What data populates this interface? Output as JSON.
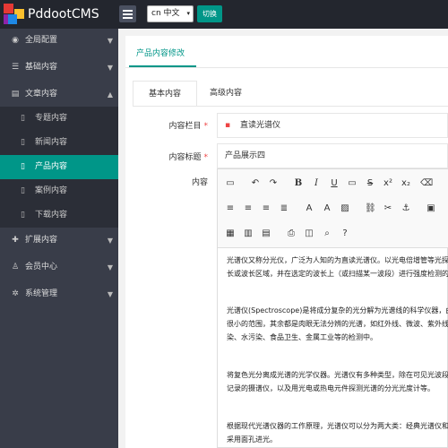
{
  "header": {
    "brand": "PddootCMS",
    "lang_value": "cn 中文",
    "switch_label": "切换"
  },
  "sidebar": {
    "items": [
      {
        "label": "全局配置",
        "icon": "globe-icon"
      },
      {
        "label": "基础内容",
        "icon": "sliders-icon"
      },
      {
        "label": "文章内容",
        "icon": "file-icon"
      },
      {
        "label": "扩展内容",
        "icon": "puzzle-icon"
      },
      {
        "label": "会员中心",
        "icon": "user-icon"
      },
      {
        "label": "系统管理",
        "icon": "gear-icon"
      }
    ],
    "subitems": [
      {
        "label": "专题内容"
      },
      {
        "label": "新闻内容"
      },
      {
        "label": "产品内容"
      },
      {
        "label": "案例内容"
      },
      {
        "label": "下载内容"
      }
    ]
  },
  "page": {
    "main_tab": "产品内容修改",
    "subtabs": [
      "基本内容",
      "高级内容"
    ],
    "fields": {
      "column_label": "内容栏目",
      "column_value": "直读光谱仪",
      "title_label": "内容标题",
      "title_value": "产品展示四",
      "content_label": "内容"
    },
    "body_paragraphs": [
      "光谱仪又称分光仪，广泛为人知的为直读光谱仪。以光电倍增管等光探测器测量谱线不同波",
      "长或波长区域，并在选定的波长上（或扫描某一波段）进行强度检测的分光仪器。",
      "光谱仪(Spectroscope)是将成分复杂的光分解为光谱线的科学仪器，由棱镜或衍射光栅等构成。",
      "很小的范围，其余都是肉眼无法分辨的光谱，如红外线、微波、紫外线、X射线等等。通过光谱",
      "染、水污染、食品卫生、金属工业等的检测中。",
      "将复色光分离成光谱的光学仪器。光谱仪有多种类型，除在可见光波段使用的光谱仪外，还有",
      "记录的摄谱仪，以及用光电或热电元件探测光谱的分光光度计等。",
      "根据现代光谱仪器的工作原理，光谱仪可以分为两大类：经典光谱仪和新型光谱仪。经典光谱",
      "采用面孔进光。"
    ]
  },
  "colors": {
    "accent": "#009688",
    "sidebar_bg": "#393d49",
    "topbar_bg": "#23262e"
  }
}
